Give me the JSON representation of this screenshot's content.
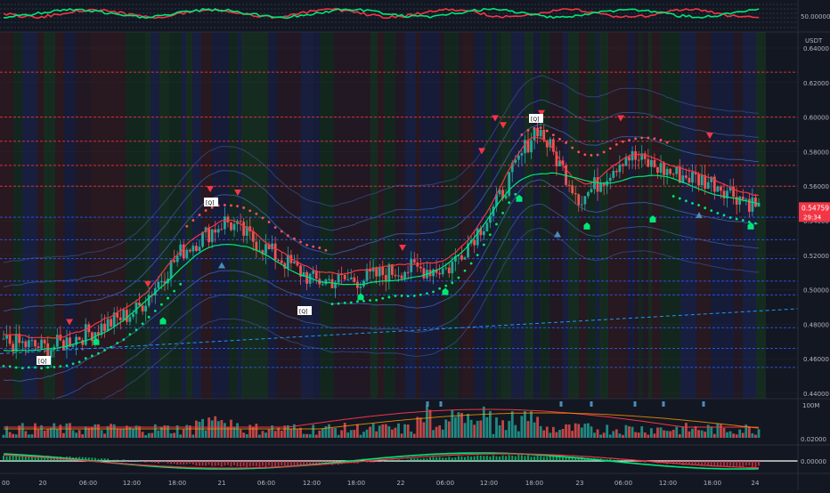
{
  "colors": {
    "background": "#131722",
    "up": "#26a69a",
    "down": "#ef5350",
    "green_line": "#00e676",
    "red_line": "#f23645",
    "blue_line": "#2962ff",
    "bb_band": "#3d5a99",
    "dots_green": "#00e676",
    "dots_red": "#ff5252",
    "axis_text": "#b2b5be",
    "price_tag": "#f23645"
  },
  "icons": {
    "sell_signal": "red-triangle-down",
    "buy_signal": "green-house-marker",
    "trend_up": "blue-triangle-up",
    "exit_signal": "red-shield-marker"
  },
  "indicator_top": {
    "level_label": "50.00000"
  },
  "indicator_bottom": {
    "level_label": "0.00000"
  },
  "volume": {
    "label_top": "100M",
    "label_mid": "0.02000"
  },
  "price_axis": {
    "currency": "USDT",
    "current_price": "0.54759",
    "countdown": "29:34"
  },
  "badges": [
    {
      "text": "[Q]"
    },
    {
      "text": "[Q]"
    },
    {
      "text": "[Q]"
    },
    {
      "text": "[Q]"
    }
  ],
  "time_labels": [
    {
      "text": "00"
    },
    {
      "text": "20"
    },
    {
      "text": "06:00"
    },
    {
      "text": "12:00"
    },
    {
      "text": "18:00"
    },
    {
      "text": "21"
    },
    {
      "text": "06:00"
    },
    {
      "text": "12:00"
    },
    {
      "text": "18:00"
    },
    {
      "text": "22"
    },
    {
      "text": "06:00"
    },
    {
      "text": "12:00"
    },
    {
      "text": "18:00"
    },
    {
      "text": "23"
    },
    {
      "text": "06:00"
    },
    {
      "text": "12:00"
    },
    {
      "text": "18:00"
    },
    {
      "text": "24"
    }
  ],
  "chart_data": {
    "type": "line",
    "title": "",
    "xlabel": "",
    "ylabel": "",
    "ylim": [
      0.44,
      0.64
    ],
    "yticks": [
      "0.64000",
      "0.62000",
      "0.60000",
      "0.58000",
      "0.56000",
      "0.54000",
      "0.52000",
      "0.50000",
      "0.48000",
      "0.46000",
      "0.44000"
    ],
    "x": [
      "19 18:00",
      "20 00:00",
      "20 06:00",
      "20 12:00",
      "20 18:00",
      "21 00:00",
      "21 06:00",
      "21 12:00",
      "21 18:00",
      "22 00:00",
      "22 06:00",
      "22 12:00",
      "22 18:00",
      "23 00:00",
      "23 06:00",
      "23 12:00",
      "23 18:00",
      "24 00:00"
    ],
    "series": [
      {
        "values": [
          0.47,
          0.466,
          0.476,
          0.488,
          0.522,
          0.54,
          0.522,
          0.505,
          0.506,
          0.512,
          0.512,
          0.545,
          0.595,
          0.552,
          0.578,
          0.568,
          0.562,
          0.548
        ]
      }
    ],
    "grid": true,
    "legend": "none"
  }
}
